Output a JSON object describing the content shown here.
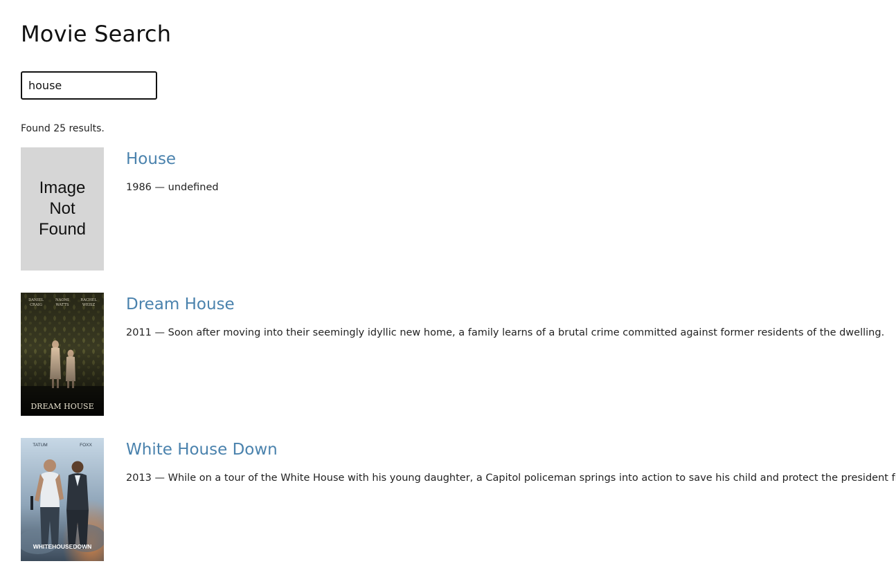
{
  "page": {
    "title": "Movie Search"
  },
  "search": {
    "value": "house",
    "placeholder": ""
  },
  "status": "Found 25 results.",
  "results": [
    {
      "title": "House",
      "year": "1986",
      "separator": "—",
      "overview": "undefined",
      "poster": {
        "missing_text": "Image\nNot\nFound"
      }
    },
    {
      "title": "Dream House",
      "year": "2011",
      "separator": "—",
      "overview": "Soon after moving into their seemingly idyllic new home, a family learns of a brutal crime committed against former residents of the dwelling.",
      "poster": {
        "top_names": [
          "DANIEL CRAIG",
          "NAOMI WATTS",
          "RACHEL WEISZ"
        ],
        "caption": "DREAM HOUSE",
        "colors": {
          "bg": "#3a3a22",
          "pattern": "#56552f",
          "floor": "#1a1a10",
          "figure": "#c9a98a"
        }
      }
    },
    {
      "title": "White House Down",
      "year": "2013",
      "separator": "—",
      "overview": "While on a tour of the White House with his young daughter, a Capitol policeman springs into action to save his child and protect the president from a heavily armed group of paramilitary invaders.",
      "poster": {
        "top_names": [
          "TATUM",
          "FOXX"
        ],
        "caption": "WHITEHOUSEDOWN",
        "colors": {
          "sky": "#b8cfdf",
          "smoke": "#7b8fa3",
          "dark": "#2b3440",
          "accent": "#d9622b"
        }
      }
    }
  ]
}
